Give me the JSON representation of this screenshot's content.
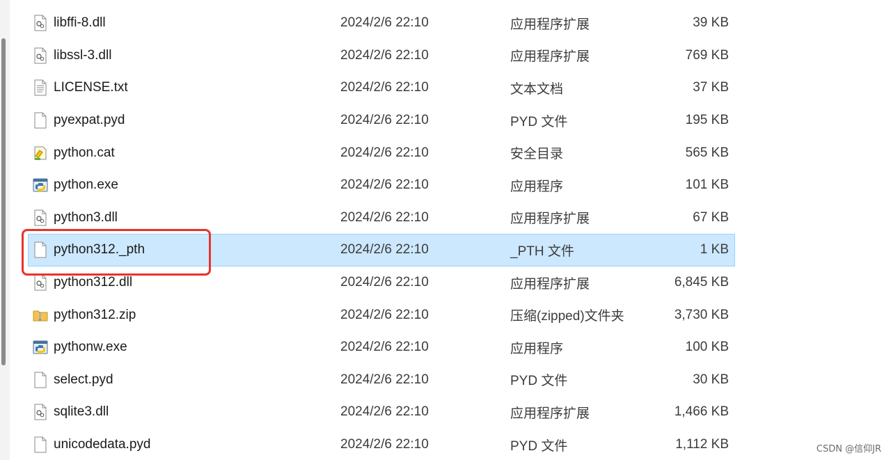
{
  "files": [
    {
      "name": "libffi-8.dll",
      "date": "2024/2/6 22:10",
      "type": "应用程序扩展",
      "size": "39 KB",
      "icon": "dll-file-icon"
    },
    {
      "name": "libssl-3.dll",
      "date": "2024/2/6 22:10",
      "type": "应用程序扩展",
      "size": "769 KB",
      "icon": "dll-file-icon"
    },
    {
      "name": "LICENSE.txt",
      "date": "2024/2/6 22:10",
      "type": "文本文档",
      "size": "37 KB",
      "icon": "text-file-icon"
    },
    {
      "name": "pyexpat.pyd",
      "date": "2024/2/6 22:10",
      "type": "PYD 文件",
      "size": "195 KB",
      "icon": "blank-file-icon"
    },
    {
      "name": "python.cat",
      "date": "2024/2/6 22:10",
      "type": "安全目录",
      "size": "565 KB",
      "icon": "security-catalog-icon"
    },
    {
      "name": "python.exe",
      "date": "2024/2/6 22:10",
      "type": "应用程序",
      "size": "101 KB",
      "icon": "python-exe-icon"
    },
    {
      "name": "python3.dll",
      "date": "2024/2/6 22:10",
      "type": "应用程序扩展",
      "size": "67 KB",
      "icon": "dll-file-icon"
    },
    {
      "name": "python312._pth",
      "date": "2024/2/6 22:10",
      "type": "_PTH 文件",
      "size": "1 KB",
      "icon": "blank-file-icon",
      "selected": true
    },
    {
      "name": "python312.dll",
      "date": "2024/2/6 22:10",
      "type": "应用程序扩展",
      "size": "6,845 KB",
      "icon": "dll-file-icon"
    },
    {
      "name": "python312.zip",
      "date": "2024/2/6 22:10",
      "type": "压缩(zipped)文件夹",
      "size": "3,730 KB",
      "icon": "zip-folder-icon"
    },
    {
      "name": "pythonw.exe",
      "date": "2024/2/6 22:10",
      "type": "应用程序",
      "size": "100 KB",
      "icon": "python-exe-icon"
    },
    {
      "name": "select.pyd",
      "date": "2024/2/6 22:10",
      "type": "PYD 文件",
      "size": "30 KB",
      "icon": "blank-file-icon"
    },
    {
      "name": "sqlite3.dll",
      "date": "2024/2/6 22:10",
      "type": "应用程序扩展",
      "size": "1,466 KB",
      "icon": "dll-file-icon"
    },
    {
      "name": "unicodedata.pyd",
      "date": "2024/2/6 22:10",
      "type": "PYD 文件",
      "size": "1,112 KB",
      "icon": "blank-file-icon"
    }
  ],
  "watermark": "CSDN @信仰JR",
  "colors": {
    "selection_bg": "#cce8ff",
    "selection_border": "#99d1ff",
    "highlight_red": "#e8322a"
  }
}
